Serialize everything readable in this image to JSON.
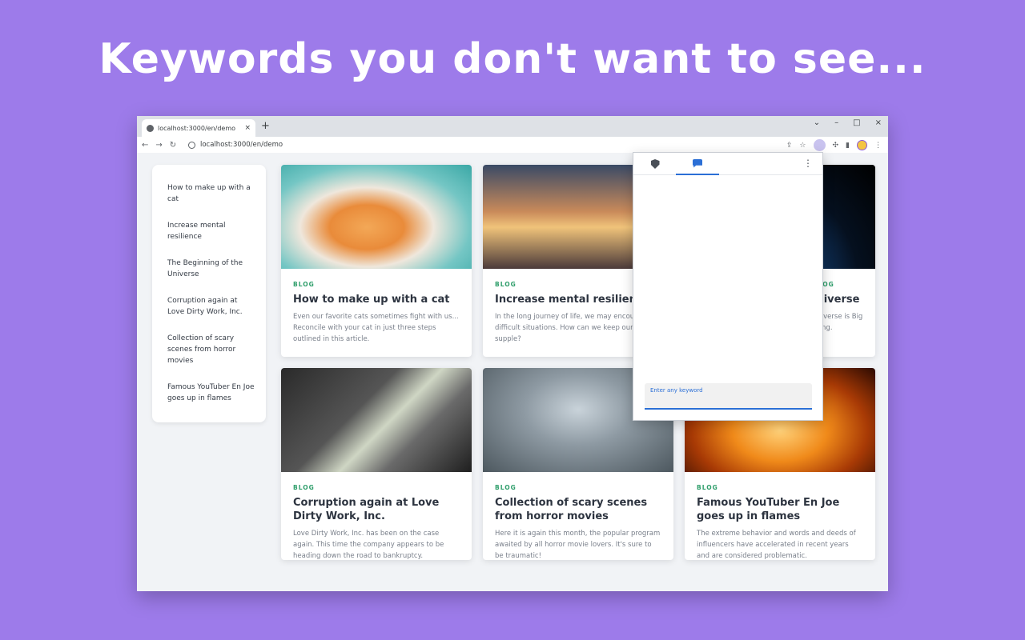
{
  "headline": "Keywords you don't want to see...",
  "browser": {
    "tab_title": "localhost:3000/en/demo",
    "tab_close": "×",
    "new_tab": "+",
    "url": "localhost:3000/en/demo",
    "controls": {
      "chevron": "⌄",
      "minimize": "–",
      "maximize": "□",
      "close": "×"
    },
    "nav": {
      "back": "←",
      "forward": "→",
      "reload": "↻"
    },
    "toolbar_icons": {
      "share": "⇪",
      "star": "☆",
      "puzzle": "✣",
      "sidepanel": "▮",
      "menu": "⋮"
    }
  },
  "sidebar": {
    "items": [
      "How to make up with a cat",
      "Increase mental resilience",
      "The Beginning of the Universe",
      "Corruption again at Love Dirty Work, Inc.",
      "Collection of scary scenes from horror movies",
      "Famous YouTuber En Joe goes up in flames"
    ]
  },
  "cards": [
    {
      "tag": "BLOG",
      "title": "How to make up with a cat",
      "desc": "Even our favorite cats sometimes fight with us... Reconcile with your cat in just three steps outlined in this article."
    },
    {
      "tag": "BLOG",
      "title": "Increase mental resilience",
      "desc": "In the long journey of life, we may encou difficult situations. How can we keep our supple?"
    },
    {
      "tag": "BLOG",
      "title": "iniverse",
      "desc": "universe is Big Bang."
    },
    {
      "tag": "BLOG",
      "title": "Corruption again at Love Dirty Work, Inc.",
      "desc": "Love Dirty Work, Inc. has been on the case again. This time the company appears to be heading down the road to bankruptcy."
    },
    {
      "tag": "BLOG",
      "title": "Collection of scary scenes from horror movies",
      "desc": "Here it is again this month, the popular program awaited by all horror movie lovers. It's sure to be traumatic!"
    },
    {
      "tag": "BLOG",
      "title": "Famous YouTuber En Joe goes up in flames",
      "desc": "The extreme behavior and words and deeds of influencers have accelerated in recent years and are considered problematic."
    }
  ],
  "popup": {
    "menu": "⋮",
    "keyword_label": "Enter any keyword",
    "keyword_value": ""
  }
}
